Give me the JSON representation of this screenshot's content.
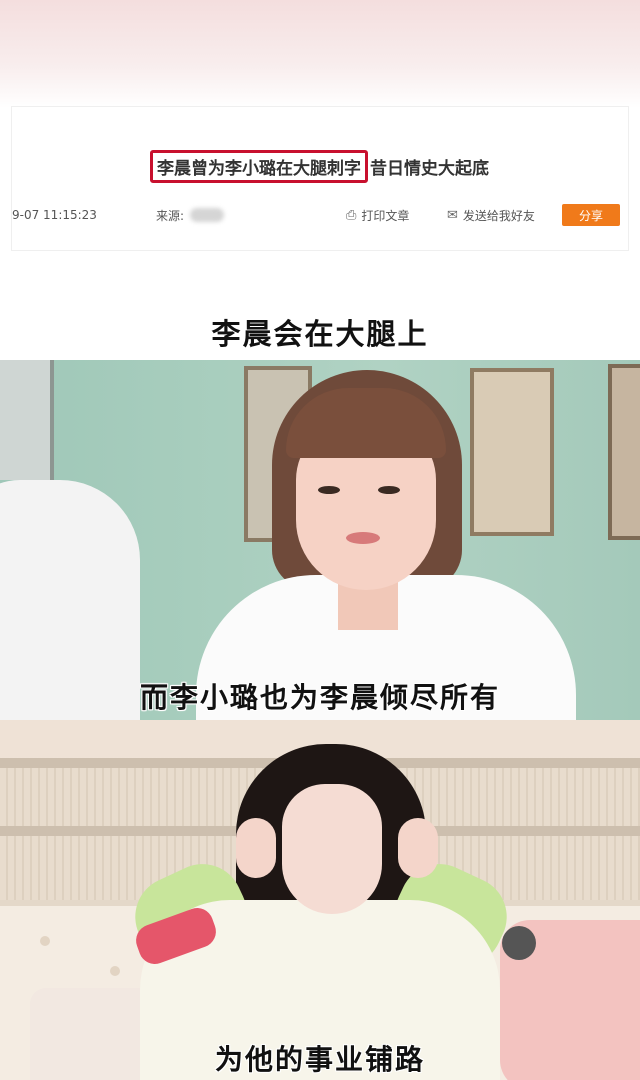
{
  "news": {
    "headline_highlight": "李晨曾为李小璐在大腿刺字",
    "headline_rest": "昔日情史大起底",
    "time": "9-07 11:15:23",
    "source_label": "来源:",
    "print_label": "打印文章",
    "send_label": "发送给我好友",
    "share_label": "分享"
  },
  "captions": {
    "first": "李晨会在大腿上",
    "second": "而李小璐也为李晨倾尽所有",
    "third": "为他的事业铺路"
  },
  "colors": {
    "highlight_border": "#c8102e",
    "share_button": "#f07a1a"
  }
}
